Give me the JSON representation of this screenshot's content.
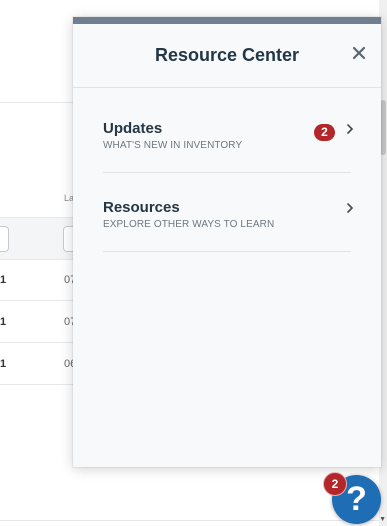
{
  "background": {
    "column_header": "La",
    "rows": [
      {
        "count": "1",
        "date": "07"
      },
      {
        "count": "1",
        "date": "07"
      },
      {
        "count": "1",
        "date": "06"
      }
    ]
  },
  "panel": {
    "title": "Resource Center",
    "close_icon": "close-icon",
    "items": [
      {
        "title": "Updates",
        "subtitle": "WHAT'S NEW IN INVENTORY",
        "badge": "2",
        "icon": "chevron-right-icon"
      },
      {
        "title": "Resources",
        "subtitle": "EXPLORE OTHER WAYS TO LEARN",
        "icon": "chevron-right-icon"
      }
    ]
  },
  "help_launcher": {
    "label": "?",
    "badge": "2",
    "icon": "question-mark-icon"
  },
  "colors": {
    "accent_bar": "#6f7f8f",
    "badge": "#b3262a",
    "help_button": "#1f6db5",
    "title_text": "#233746"
  }
}
